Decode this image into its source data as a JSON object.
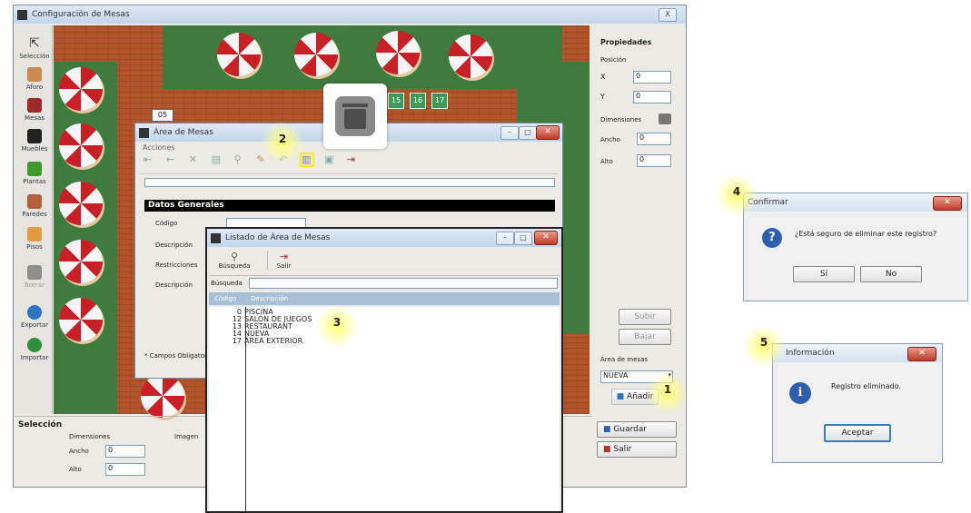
{
  "main_window": {
    "title": "Configuración de Mesas",
    "close": "X",
    "tools": [
      "Selección",
      "Aforo",
      "Mesas",
      "Muebles",
      "Plantas",
      "Paredes",
      "Pisos",
      "Borrar",
      "Exportar",
      "Importar"
    ],
    "floor_badge": "05",
    "table_numbers": [
      "15",
      "16",
      "17"
    ],
    "properties": {
      "header": "Propiedades",
      "position_label": "Posición",
      "x_label": "X",
      "x_value": "0",
      "y_label": "Y",
      "y_value": "0",
      "dimensions_label": "Dimensiones",
      "width_label": "Ancho",
      "height_label": "Alto",
      "width_value": "0",
      "height_value": "0"
    },
    "btn_scroll_up": "Subir",
    "btn_scroll_down": "Bajar",
    "area_label": "Área de mesas",
    "area_value": "NUEVA",
    "area_add_button": "Añadir",
    "save_button": "Guardar",
    "exit_button": "Salir",
    "selection": {
      "title": "Selección",
      "dimensions_label": "Dimensiones",
      "width_label": "Ancho",
      "width_value": "0",
      "height_label": "Alto",
      "height_value": "0",
      "image_label": "Imagen"
    }
  },
  "area_window": {
    "title": "Área de Mesas",
    "menu": "Acciones",
    "section_header": "Datos Generales",
    "fields": [
      "Código",
      "Descripción",
      "Restricciones",
      "Descripción"
    ],
    "required_note": "* Campos Obligatorios"
  },
  "list_window": {
    "title": "Listado de Área de Mesas",
    "search_button": "Búsqueda",
    "exit_button": "Salir",
    "search_label": "Búsqueda",
    "columns": [
      "Código",
      "Descripción"
    ],
    "rows": [
      {
        "code": "0",
        "desc": "PISCINA"
      },
      {
        "code": "12",
        "desc": "SALÓN DE JUEGOS"
      },
      {
        "code": "13",
        "desc": "RESTAURANT"
      },
      {
        "code": "14",
        "desc": "NUEVA"
      },
      {
        "code": "17",
        "desc": "ÁREA EXTERIOR"
      }
    ]
  },
  "confirm_dialog": {
    "title": "Confirmar",
    "message": "¿Está seguro de eliminar este registro?",
    "yes": "Sí",
    "no": "No"
  },
  "info_dialog": {
    "title": "Información",
    "message": "Registro eliminado.",
    "accept": "Aceptar"
  },
  "callouts": [
    "1",
    "2",
    "3",
    "4",
    "5"
  ],
  "colors": {
    "floor_green": "#3f7a3e",
    "brick": "#b2552c",
    "umbrella_red": "#c92027",
    "highlight": "#ffff66",
    "window_bg": "#eceae5"
  }
}
